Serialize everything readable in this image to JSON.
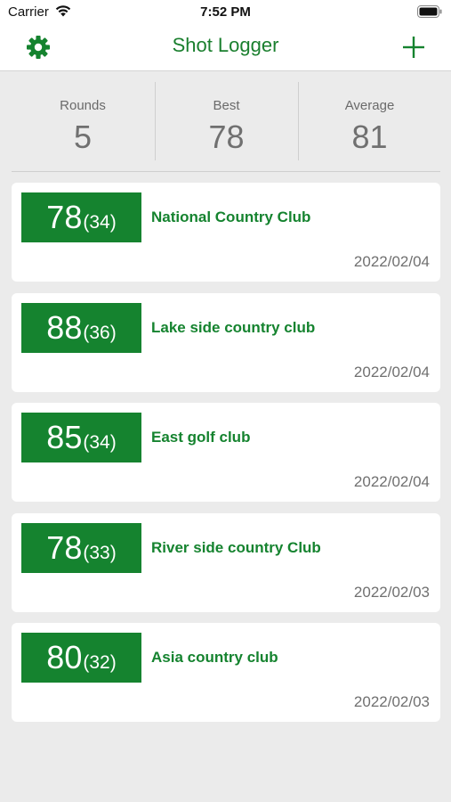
{
  "status_bar": {
    "carrier": "Carrier",
    "time": "7:52 PM",
    "wifi_icon": "wifi-icon",
    "battery_icon": "battery-icon"
  },
  "nav": {
    "title": "Shot Logger",
    "settings_icon": "gear-icon",
    "add_icon": "plus-icon",
    "accent_color": "#1a7f2e"
  },
  "stats": [
    {
      "label": "Rounds",
      "value": "5"
    },
    {
      "label": "Best",
      "value": "78"
    },
    {
      "label": "Average",
      "value": "81"
    }
  ],
  "rounds": [
    {
      "score": "78",
      "half": "(34)",
      "club": "National Country Club",
      "date": "2022/02/04"
    },
    {
      "score": "88",
      "half": "(36)",
      "club": "Lake side country club",
      "date": "2022/02/04"
    },
    {
      "score": "85",
      "half": "(34)",
      "club": "East golf club",
      "date": "2022/02/04"
    },
    {
      "score": "78",
      "half": "(33)",
      "club": "River side country Club",
      "date": "2022/02/03"
    },
    {
      "score": "80",
      "half": "(32)",
      "club": "Asia country club",
      "date": "2022/02/03"
    }
  ],
  "colors": {
    "score_box": "#15832f",
    "background": "#ebebeb",
    "card": "#ffffff"
  }
}
